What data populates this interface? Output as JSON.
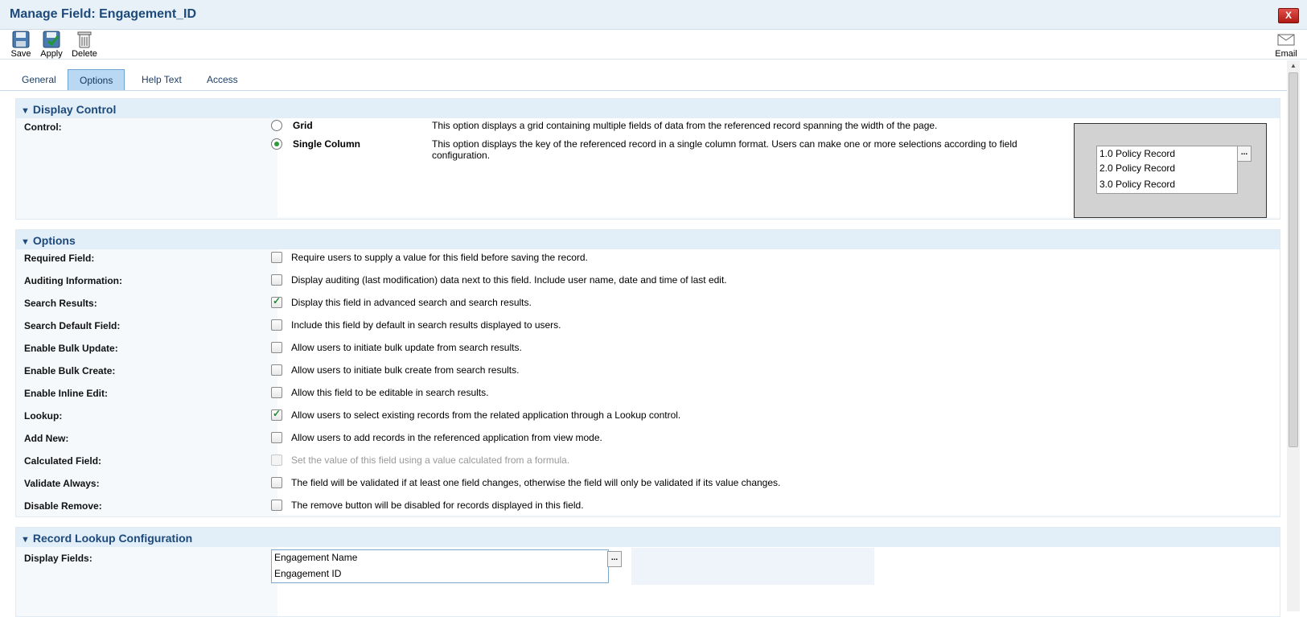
{
  "window": {
    "title": "Manage Field: Engagement_ID",
    "close_label": "X"
  },
  "toolbar": {
    "save": "Save",
    "apply": "Apply",
    "delete": "Delete",
    "email": "Email"
  },
  "tabs": [
    {
      "label": "General",
      "active": false
    },
    {
      "label": "Options",
      "active": true
    },
    {
      "label": "Help Text",
      "active": false
    },
    {
      "label": "Access",
      "active": false
    }
  ],
  "display_control": {
    "header": "Display Control",
    "control_label": "Control:",
    "options": [
      {
        "name": "Grid",
        "selected": false,
        "description": "This option displays a grid containing multiple fields of data from the referenced record spanning the width of the page."
      },
      {
        "name": "Single Column",
        "selected": true,
        "description": "This option displays the key of the referenced record in a single column format. Users can make one or more selections according to field configuration."
      }
    ],
    "preview": {
      "items": [
        "1.0 Policy Record",
        "2.0 Policy Record",
        "3.0 Policy Record"
      ],
      "button": "..."
    }
  },
  "options": {
    "header": "Options",
    "rows": [
      {
        "label": "Required Field:",
        "checked": false,
        "disabled": false,
        "description": "Require users to supply a value for this field before saving the record."
      },
      {
        "label": "Auditing Information:",
        "checked": false,
        "disabled": false,
        "description": "Display auditing (last modification) data next to this field. Include user name, date and time of last edit."
      },
      {
        "label": "Search Results:",
        "checked": true,
        "disabled": false,
        "description": "Display this field in advanced search and search results."
      },
      {
        "label": "Search Default Field:",
        "checked": false,
        "disabled": false,
        "description": "Include this field by default in search results displayed to users."
      },
      {
        "label": "Enable Bulk Update:",
        "checked": false,
        "disabled": false,
        "description": "Allow users to initiate bulk update from search results."
      },
      {
        "label": "Enable Bulk Create:",
        "checked": false,
        "disabled": false,
        "description": "Allow users to initiate bulk create from search results."
      },
      {
        "label": "Enable Inline Edit:",
        "checked": false,
        "disabled": false,
        "description": "Allow this field to be editable in search results."
      },
      {
        "label": "Lookup:",
        "checked": true,
        "disabled": false,
        "description": "Allow users to select existing records from the related application through a Lookup control."
      },
      {
        "label": "Add New:",
        "checked": false,
        "disabled": false,
        "description": "Allow users to add records in the referenced application from view mode."
      },
      {
        "label": "Calculated Field:",
        "checked": false,
        "disabled": true,
        "description": "Set the value of this field using a value calculated from a formula."
      },
      {
        "label": "Validate Always:",
        "checked": false,
        "disabled": false,
        "description": "The field will be validated if at least one field changes, otherwise the field will only be validated if its value changes."
      },
      {
        "label": "Disable Remove:",
        "checked": false,
        "disabled": false,
        "description": "The remove button will be disabled for records displayed in this field."
      }
    ]
  },
  "record_lookup": {
    "header": "Record Lookup Configuration",
    "display_fields_label": "Display Fields:",
    "display_fields": [
      "Engagement Name",
      "Engagement ID"
    ],
    "button": "..."
  }
}
